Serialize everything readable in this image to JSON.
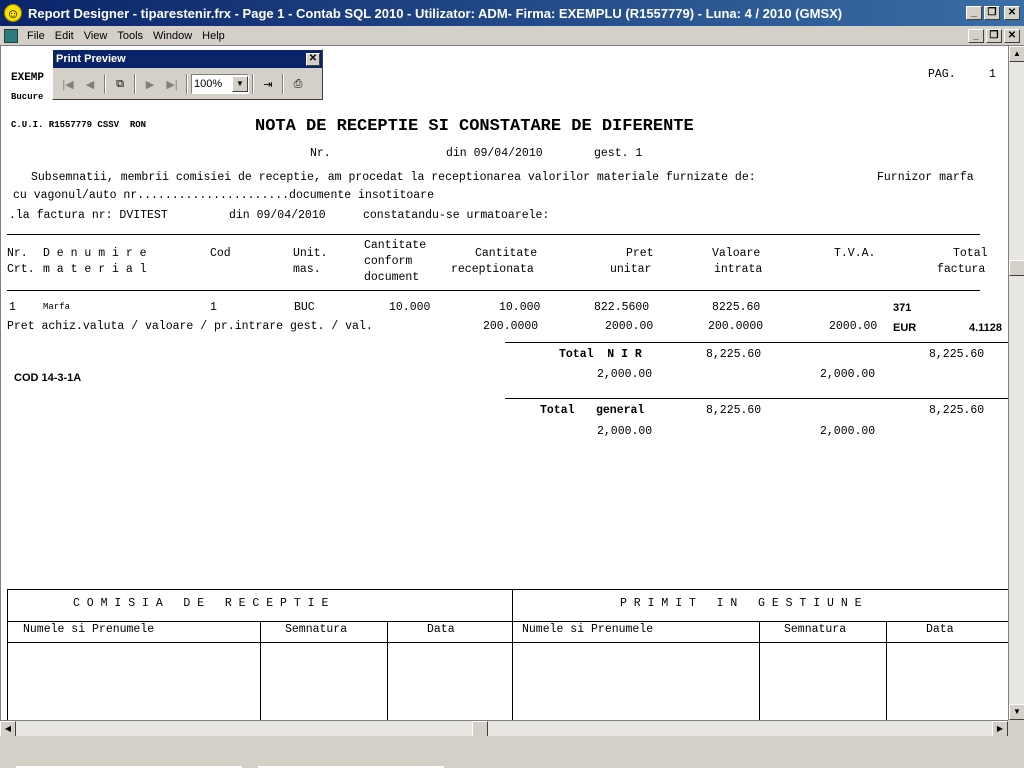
{
  "window": {
    "title": "Report Designer - tiparestenir.frx - Page 1 - Contab SQL 2010 - Utilizator: ADM- Firma: EXEMPLU (R1557779) - Luna: 4 / 2010      (GMSX)",
    "min": "_",
    "max": "❐",
    "close": "✕"
  },
  "menu": [
    "File",
    "Edit",
    "View",
    "Tools",
    "Window",
    "Help"
  ],
  "print_preview": {
    "title": "Print Preview",
    "zoom": "100%",
    "icons": [
      "first-page-icon",
      "prev-page-icon",
      "multi-page-icon",
      "next-page-icon",
      "last-page-icon",
      "exit-icon",
      "print-icon"
    ]
  },
  "report": {
    "company": "EXEMP",
    "city": "Bucure",
    "page_label": "PAG.",
    "page_no": "1",
    "cui": "C.U.I. R1557779 CSSV  RON",
    "title": "NOTA DE RECEPTIE SI CONSTATARE DE DIFERENTE",
    "nr_label": "Nr.",
    "din_label": "din 09/04/2010",
    "gest": "gest. 1",
    "para1": "Subsemnatii, membrii comisiei de receptie, am procedat la receptionarea valorilor materiale furnizate de:",
    "furnizor": "Furnizor marfa",
    "para2": "cu vagonul/auto nr......................documente insotitoare",
    "para3_a": ".la factura nr: DVITEST",
    "para3_b": "din 09/04/2010",
    "para3_c": "constatandu-se urmatoarele:",
    "headers": {
      "nr": "Nr.",
      "crt": "Crt.",
      "den1": "D e n u m i r e",
      "den2": "m a t e r i a l",
      "cod": "Cod",
      "um1": "Unit.",
      "um2": "mas.",
      "cc1": "Cantitate",
      "cc2": "conform",
      "cc3": "document",
      "cr1": "Cantitate",
      "cr2": "receptionata",
      "pu1": "Pret",
      "pu2": "unitar",
      "vi1": "Valoare",
      "vi2": "intrata",
      "tva": "T.V.A.",
      "tf1": "Total",
      "tf2": "factura"
    },
    "row": {
      "nr": "1",
      "den": "Marfa",
      "cod": "1",
      "um": "BUC",
      "cant_doc": "10.000",
      "cant_rec": "10.000",
      "pret": "822.5600",
      "valoare": "8225.60",
      "tva": "371"
    },
    "row2": {
      "label": "Pret achiz.valuta / valoare / pr.intrare gest. / val.",
      "v1": "200.0000",
      "v2": "2000.00",
      "v3": "200.0000",
      "v4": "2000.00",
      "cur": "EUR",
      "rate": "4.1128"
    },
    "cod_form": "COD 14-3-1A",
    "total_nir_label": "Total  N I R",
    "total_nir_v": "8,225.60",
    "total_nir_tf": "8,225.60",
    "total_nir_sub1": "2,000.00",
    "total_nir_sub2": "2,000.00",
    "total_gen_label1": "Total",
    "total_gen_label2": "general",
    "total_gen_v": "8,225.60",
    "total_gen_tf": "8,225.60",
    "total_gen_sub1": "2,000.00",
    "total_gen_sub2": "2,000.00",
    "comisia": "C O M I S I A   D E   R E C E P T I E",
    "primit": "P R I M I T   I N   G E S T I U N E",
    "numele": "Numele si Prenumele",
    "semnatura": "Semnatura",
    "data": "Data"
  }
}
